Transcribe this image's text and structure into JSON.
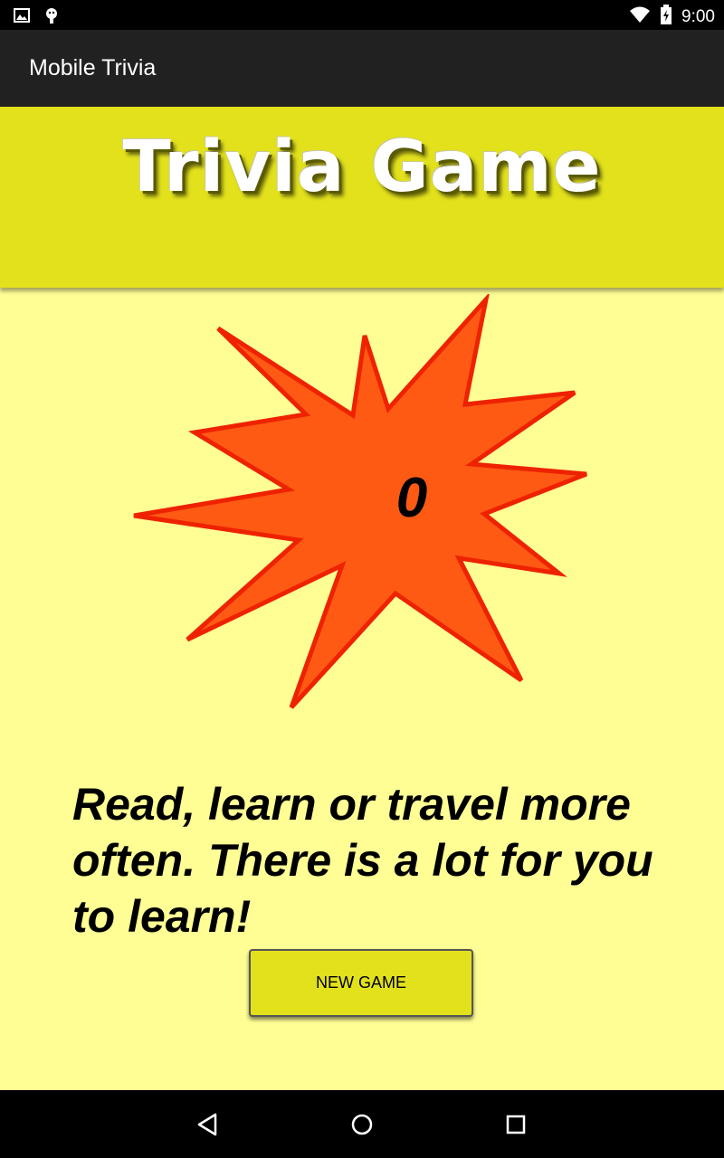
{
  "status_bar": {
    "time": "9:00",
    "icons": [
      "image-icon",
      "android-icon",
      "wifi-icon",
      "battery-icon"
    ]
  },
  "app_bar": {
    "title": "Mobile Trivia"
  },
  "banner": {
    "title": "Trivia Game"
  },
  "score": {
    "value": "0"
  },
  "message": {
    "text": "Read, learn or travel more often.  There is a lot for you to learn!"
  },
  "new_game_button": {
    "label": "NEW GAME"
  },
  "nav_bar": {
    "buttons": [
      "back-icon",
      "home-icon",
      "recents-icon"
    ]
  },
  "colors": {
    "background": "#fffe94",
    "banner": "#e2e11c",
    "star_fill": "#ff5a14",
    "star_stroke": "#ee2200"
  }
}
